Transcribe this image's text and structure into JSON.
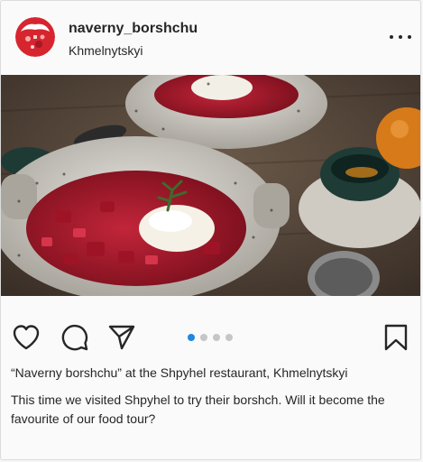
{
  "post": {
    "username": "naverny_borshchu",
    "location": "Khmelnytskyi",
    "carousel": {
      "total": 4,
      "active_index": 0
    },
    "caption_title": "“Naverny borshchu” at the Shpyhel restaurant, Khmelnytskyi",
    "caption_body": "This time we visited Shpyhel to try their borshch. Will it become the favourite of our food tour?"
  },
  "icons": {
    "more": "more-options-icon",
    "like": "heart-icon",
    "comment": "comment-bubble-icon",
    "share": "paper-plane-icon",
    "save": "bookmark-icon"
  },
  "colors": {
    "accent_dot": "#1f87e0",
    "avatar_red": "#d6252f"
  }
}
